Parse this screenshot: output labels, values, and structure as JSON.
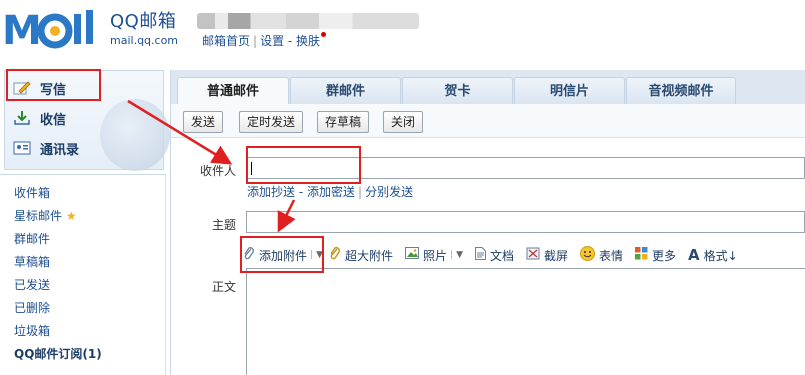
{
  "header": {
    "logo_text": "MOil",
    "brand_title": "QQ邮箱",
    "brand_domain": "mail.qq.com",
    "links": [
      "邮箱首页",
      "设置",
      "换肤"
    ]
  },
  "sidebar": {
    "actions": [
      {
        "label": "写信",
        "icon": "pencil-icon"
      },
      {
        "label": "收信",
        "icon": "inbox-download-icon"
      },
      {
        "label": "通讯录",
        "icon": "contacts-card-icon"
      }
    ],
    "folders": [
      {
        "label": "收件箱"
      },
      {
        "label": "星标邮件",
        "star": "★"
      },
      {
        "label": "群邮件"
      },
      {
        "label": "草稿箱"
      },
      {
        "label": "已发送"
      },
      {
        "label": "已删除"
      },
      {
        "label": "垃圾箱"
      },
      {
        "label": "QQ邮件订阅(1)"
      }
    ]
  },
  "tabs": [
    "普通邮件",
    "群邮件",
    "贺卡",
    "明信片",
    "音视频邮件"
  ],
  "toolbar": {
    "send": "发送",
    "scheduled_send": "定时发送",
    "save_draft": "存草稿",
    "close": "关闭"
  },
  "compose": {
    "to_label": "收件人",
    "to_value": "",
    "add_cc": "添加抄送",
    "dash": "-",
    "add_bcc": "添加密送",
    "separate_send": "分别发送",
    "subject_label": "主题",
    "subject_value": "",
    "body_label": "正文"
  },
  "format_bar": [
    {
      "label": "添加附件",
      "icon": "paperclip-icon"
    },
    {
      "label": "超大附件",
      "icon": "paperclip-large-icon"
    },
    {
      "label": "照片",
      "icon": "photo-icon"
    },
    {
      "label": "文档",
      "icon": "document-icon"
    },
    {
      "label": "截屏",
      "icon": "screenshot-icon"
    },
    {
      "label": "表情",
      "icon": "smiley-icon"
    },
    {
      "label": "更多",
      "icon": "grid-more-icon"
    },
    {
      "label": "格式↓",
      "icon": "font-format-icon"
    }
  ],
  "colors": {
    "brand": "#1d4f91",
    "annotation": "#e02020"
  }
}
